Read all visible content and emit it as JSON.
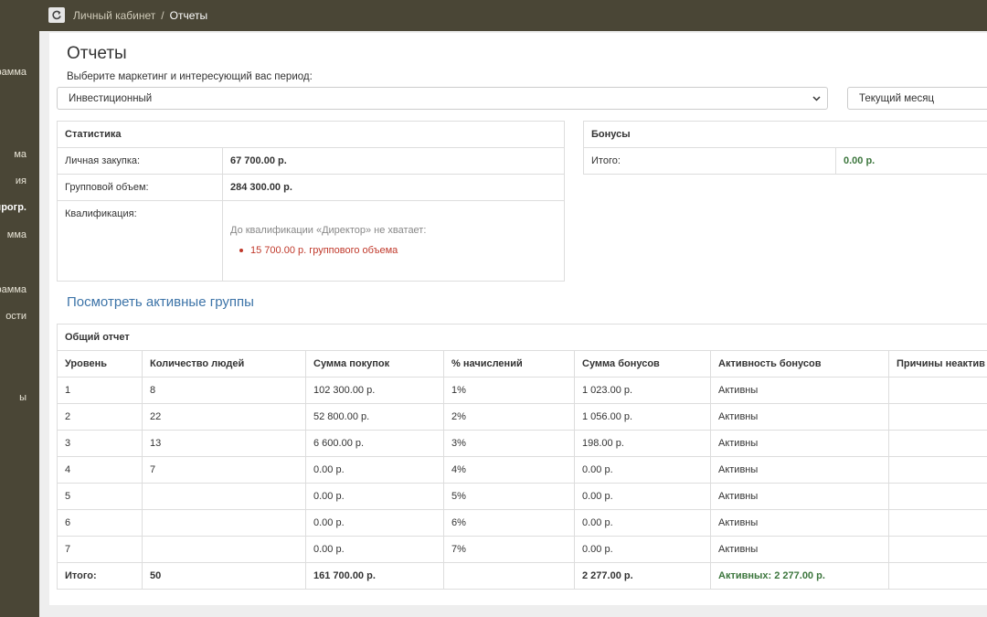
{
  "header": {
    "breadcrumb_home": "Личный кабинет",
    "breadcrumb_sep": "/",
    "breadcrumb_current": "Отчеты"
  },
  "sidebar": {
    "items": [
      {
        "label": "рамма"
      },
      {
        "label": "ма"
      },
      {
        "label": "ия"
      },
      {
        "label": "прогр.",
        "active": true
      },
      {
        "label": "мма"
      },
      {
        "label": "рамма"
      },
      {
        "label": "ости"
      },
      {
        "label": "ы"
      }
    ]
  },
  "page": {
    "title": "Отчеты",
    "select_label": "Выберите маркетинг и интересующий вас период:",
    "marketing_select": "Инвестиционный",
    "period_select": "Текущий месяц"
  },
  "statistics": {
    "title": "Статистика",
    "rows": [
      {
        "label": "Личная закупка:",
        "value": "67 700.00 р."
      },
      {
        "label": "Групповой объем:",
        "value": "284 300.00 р."
      }
    ],
    "qualification_label": "Квалификация:",
    "qualification_note": "До квалификации «Директор» не хватает:",
    "qualification_missing": "15 700.00 р. группового объема"
  },
  "bonuses": {
    "title": "Бонусы",
    "total_label": "Итого:",
    "total_value": "0.00 р."
  },
  "link_active_groups": "Посмотреть активные группы",
  "report": {
    "title": "Общий отчет",
    "columns": [
      "Уровень",
      "Количество людей",
      "Сумма покупок",
      "% начислений",
      "Сумма бонусов",
      "Активность бонусов",
      "Причины неактив"
    ],
    "rows": [
      [
        "1",
        "8",
        "102 300.00 р.",
        "1%",
        "1 023.00 р.",
        "Активны",
        ""
      ],
      [
        "2",
        "22",
        "52 800.00 р.",
        "2%",
        "1 056.00 р.",
        "Активны",
        ""
      ],
      [
        "3",
        "13",
        "6 600.00 р.",
        "3%",
        "198.00 р.",
        "Активны",
        ""
      ],
      [
        "4",
        "7",
        "0.00 р.",
        "4%",
        "0.00 р.",
        "Активны",
        ""
      ],
      [
        "5",
        "",
        "0.00 р.",
        "5%",
        "0.00 р.",
        "Активны",
        ""
      ],
      [
        "6",
        "",
        "0.00 р.",
        "6%",
        "0.00 р.",
        "Активны",
        ""
      ],
      [
        "7",
        "",
        "0.00 р.",
        "7%",
        "0.00 р.",
        "Активны",
        ""
      ]
    ],
    "total": [
      "Итого:",
      "50",
      "161 700.00 р.",
      "",
      "2 277.00 р.",
      "Активных: 2 277.00 р.",
      ""
    ]
  }
}
